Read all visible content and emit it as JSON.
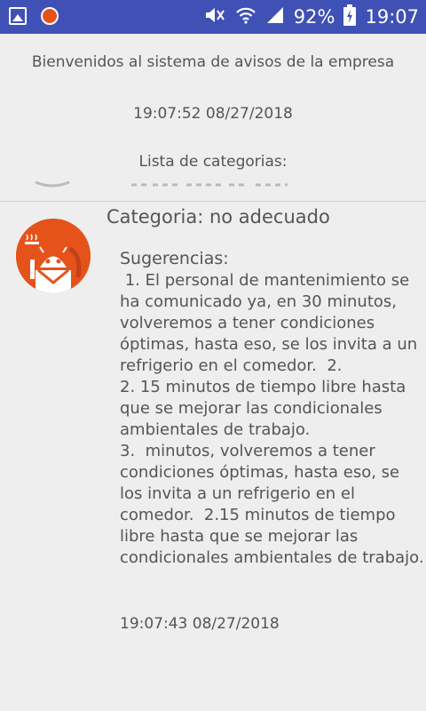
{
  "status_bar": {
    "battery": "92%",
    "time": "19:07",
    "icons": [
      "gallery-icon",
      "app-notification-icon",
      "mute-icon",
      "wifi-icon",
      "signal-icon",
      "battery-charging-icon"
    ]
  },
  "header": {
    "welcome": "Bienvenidos al sistema de avisos de la empresa",
    "timestamp": "19:07:52 08/27/2018",
    "list_title": "Lista de categorias:"
  },
  "item": {
    "category": "Categoria: no adecuado",
    "suggestions_title": "Sugerencias:",
    "suggestions_body": " 1. El personal de mantenimiento se ha comunicado ya, en 30 minutos, volveremos a tener condiciones óptimas, hasta eso, se los invita a un refrigerio en el comedor.  2.\n2. 15 minutos de tiempo libre hasta que se mejorar las condicionales ambientales de trabajo.\n3.  minutos, volveremos a tener condiciones óptimas, hasta eso, se los invita a un refrigerio en el comedor.  2.15 minutos de tiempo libre hasta que se mejorar las condicionales ambientales de trabajo.",
    "timestamp": "19:07:43 08/27/2018"
  },
  "colors": {
    "status_bar": "#3f51b5",
    "avatar": "#e5531a",
    "background": "#eeeeee",
    "text": "#555555"
  }
}
